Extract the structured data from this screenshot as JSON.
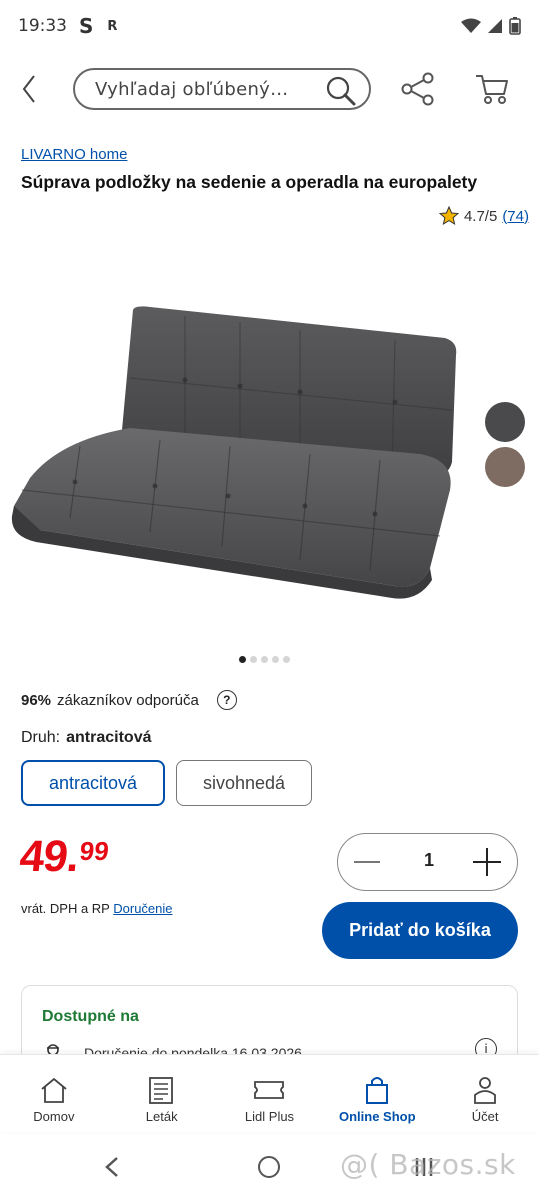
{
  "status_bar": {
    "time": "19:33",
    "icon_s": "S",
    "icon_r": "R"
  },
  "search": {
    "placeholder": "Vyhľadaj obľúbený…"
  },
  "product": {
    "brand": "LIVARNO home",
    "title": "Súprava podložky na sedenie a operadla na europalety",
    "rating": "4.7/5",
    "rating_count": "(74)",
    "recommend_percent": "96%",
    "recommend_text": "zákazníkov odporúča",
    "variant_label": "Druh:",
    "variant_selected": "antracitová",
    "variants": [
      "antracitová",
      "sivohnedá"
    ],
    "swatch_colors": [
      "#4a4a4c",
      "#7e6c62"
    ],
    "image_pages": 5,
    "image_current": 1
  },
  "price": {
    "main": "49",
    "cents": "99",
    "color": "#e60a14",
    "vat_text": "vrát. DPH a RP",
    "delivery_link": "Doručenie"
  },
  "quantity": {
    "value": "1"
  },
  "add_to_cart": {
    "label": "Pridať do košíka"
  },
  "availability": {
    "title": "Dostupné na",
    "delivery_text": "Doručenie do pondelka 16.03.2026"
  },
  "bottom_nav": {
    "items": [
      {
        "label": "Domov",
        "icon": "home-icon"
      },
      {
        "label": "Leták",
        "icon": "leaflet-icon"
      },
      {
        "label": "Lidl Plus",
        "icon": "ticket-icon"
      },
      {
        "label": "Online Shop",
        "icon": "shopping-bag-icon",
        "active": true
      },
      {
        "label": "Účet",
        "icon": "user-icon"
      }
    ]
  },
  "watermark": "@( Bazos.sk",
  "colors": {
    "accent": "#0050aa",
    "price": "#e60a14",
    "available": "#1e7a35"
  }
}
